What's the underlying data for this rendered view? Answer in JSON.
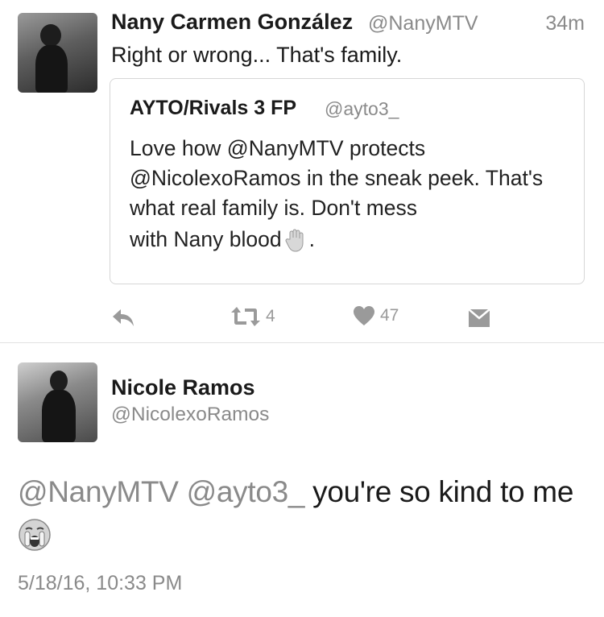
{
  "tweet1": {
    "name": "Nany Carmen González",
    "handle": "@NanyMTV",
    "time": "34m",
    "text": "Right or wrong... That's family.",
    "quote": {
      "name": "AYTO/Rivals 3 FP",
      "handle": "@ayto3_",
      "text": "Love how @NanyMTV protects @NicolexoRamos in the sneak peek. That's what real family is. Don't mess",
      "last_line": "with Nany blood",
      "last_line_end": ".",
      "emoji_icon": "raised-hand-icon"
    },
    "actions": {
      "retweet_count": "4",
      "like_count": "47"
    }
  },
  "tweet2": {
    "name": "Nicole Ramos",
    "handle": "@NicolexoRamos",
    "text_mentions": "@NanyMTV @ayto3_",
    "text_body": " you're so kind to me",
    "emoji_icon": "crying-face-icon",
    "date": "5/18/16, 10:33 PM"
  }
}
